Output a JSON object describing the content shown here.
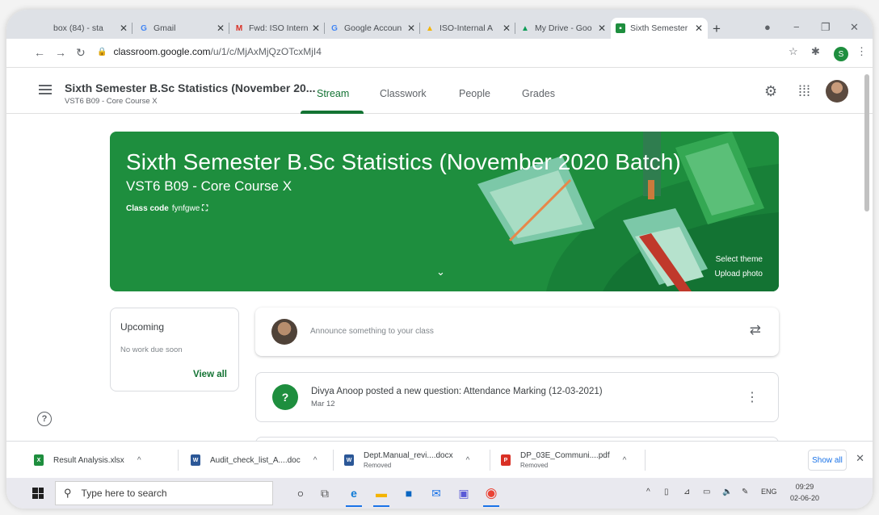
{
  "browser": {
    "tabs": [
      {
        "title": "box (84) - sta",
        "favicon": "inbox-icon",
        "fav_text": "",
        "color": "#888"
      },
      {
        "title": "Gmail",
        "favicon": "google-icon",
        "fav_text": "G",
        "color": "#4285f4"
      },
      {
        "title": "Fwd: ISO Intern",
        "favicon": "gmail-icon",
        "fav_text": "M",
        "color": "#d93025"
      },
      {
        "title": "Google Accoun",
        "favicon": "google-icon",
        "fav_text": "G",
        "color": "#4285f4"
      },
      {
        "title": "ISO-Internal A",
        "favicon": "drive-icon",
        "fav_text": "▲",
        "color": "#f4b400"
      },
      {
        "title": "My Drive - Goo",
        "favicon": "drive-icon",
        "fav_text": "▲",
        "color": "#0f9d58"
      },
      {
        "title": "Sixth Semester",
        "favicon": "classroom-icon",
        "fav_text": "▪",
        "color": "#1e8e3e"
      }
    ],
    "new_tab": "+",
    "url_host": "classroom.google.com",
    "url_path": "/u/1/c/MjAxMjQzOTcxMjI4",
    "profile_initial": "S"
  },
  "classroom": {
    "class_title": "Sixth Semester B.Sc Statistics (November 20...",
    "class_subtitle": "VST6 B09 - Core Course X",
    "nav_tabs": [
      "Stream",
      "Classwork",
      "People",
      "Grades"
    ],
    "banner": {
      "title": "Sixth Semester B.Sc Statistics (November 2020 Batch)",
      "subtitle": "VST6 B09 - Core Course X",
      "class_code_label": "Class code",
      "class_code": "fynfgwe",
      "select_theme": "Select theme",
      "upload_photo": "Upload photo"
    },
    "upcoming": {
      "title": "Upcoming",
      "empty": "No work due soon",
      "view_all": "View all"
    },
    "announce_placeholder": "Announce something to your class",
    "post": {
      "text": "Divya Anoop posted a new question: Attendance Marking (12-03-2021)",
      "date": "Mar 12"
    },
    "accent_color": "#1e8e3e"
  },
  "downloads": {
    "items": [
      {
        "name": "Result Analysis.xlsx",
        "status": "",
        "icon": "excel-file-icon",
        "color": "#1e8e3e",
        "glyph": "X"
      },
      {
        "name": "Audit_check_list_A....doc",
        "status": "",
        "icon": "word-file-icon",
        "color": "#2b5797",
        "glyph": "W"
      },
      {
        "name": "Dept.Manual_revi....docx",
        "status": "Removed",
        "icon": "word-file-icon",
        "color": "#2b5797",
        "glyph": "W"
      },
      {
        "name": "DP_03E_Communi....pdf",
        "status": "Removed",
        "icon": "pdf-file-icon",
        "color": "#d93025",
        "glyph": "P"
      }
    ],
    "show_all": "Show all"
  },
  "taskbar": {
    "search_placeholder": "Type here to search",
    "language": "ENG",
    "time": "09:29",
    "date": "02-06-20"
  }
}
